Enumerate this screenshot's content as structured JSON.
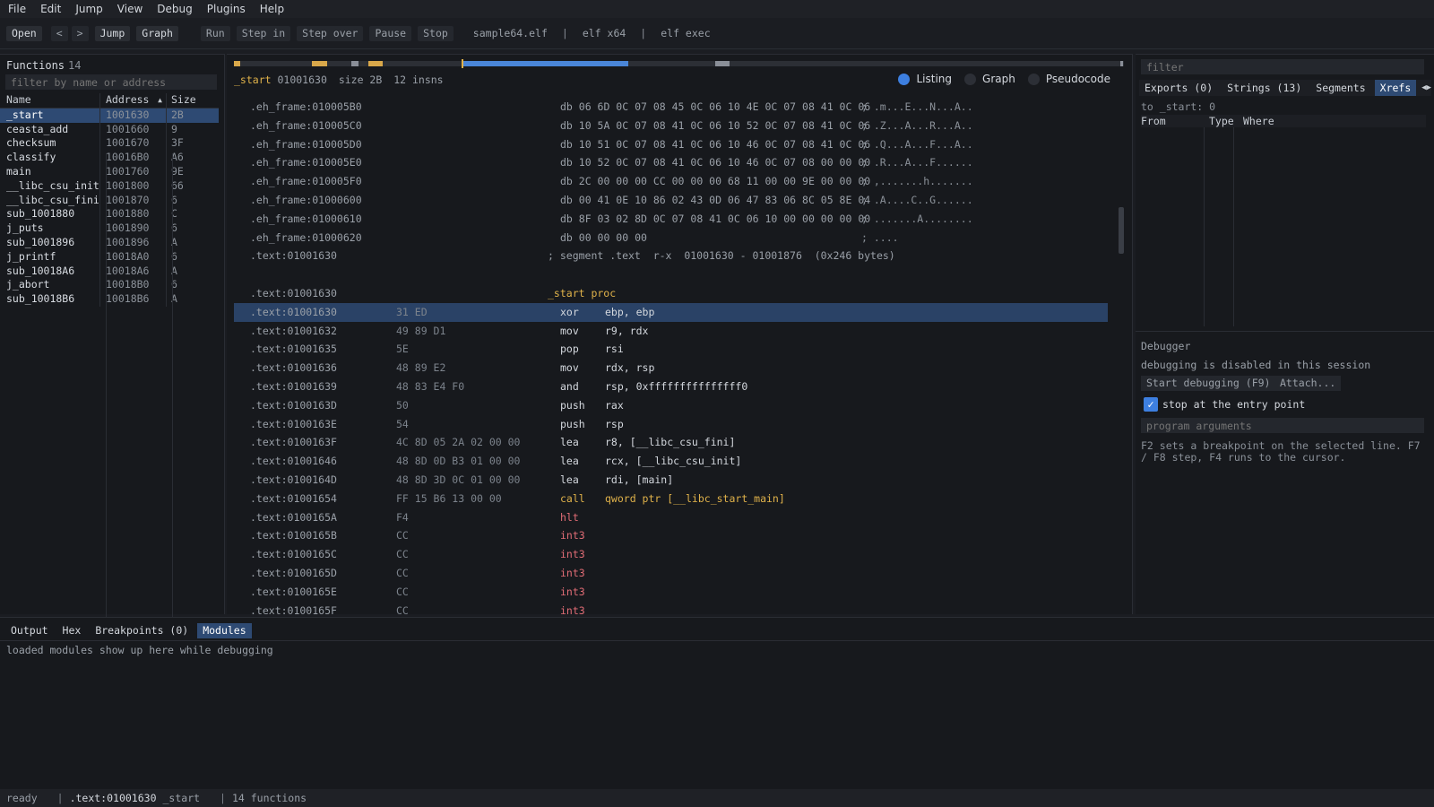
{
  "menu": [
    "File",
    "Edit",
    "Jump",
    "View",
    "Debug",
    "Plugins",
    "Help"
  ],
  "toolbar": {
    "open": "Open",
    "back": "<",
    "forward": ">",
    "jump": "Jump",
    "graph": "Graph",
    "run": "Run",
    "step_in": "Step in",
    "step_over": "Step over",
    "pause": "Pause",
    "stop": "Stop",
    "file": "sample64.elf",
    "sep": "|",
    "arch": "elf x64",
    "kind": "elf exec"
  },
  "functions": {
    "title": "Functions",
    "count": "14",
    "filter_placeholder": "filter by name or address",
    "columns": {
      "name": "Name",
      "address": "Address",
      "sort_indicator": "▲",
      "size": "Size"
    },
    "rows": [
      {
        "name": "_start",
        "address": "1001630",
        "size": "2B",
        "selected": true
      },
      {
        "name": "ceasta_add",
        "address": "1001660",
        "size": "9"
      },
      {
        "name": "checksum",
        "address": "1001670",
        "size": "3F"
      },
      {
        "name": "classify",
        "address": "10016B0",
        "size": "A6"
      },
      {
        "name": "main",
        "address": "1001760",
        "size": "9E"
      },
      {
        "name": "__libc_csu_init",
        "address": "1001800",
        "size": "66"
      },
      {
        "name": "__libc_csu_fini",
        "address": "1001870",
        "size": "6"
      },
      {
        "name": "sub_1001880",
        "address": "1001880",
        "size": "C"
      },
      {
        "name": "j_puts",
        "address": "1001890",
        "size": "6"
      },
      {
        "name": "sub_1001896",
        "address": "1001896",
        "size": "A"
      },
      {
        "name": "j_printf",
        "address": "10018A0",
        "size": "6"
      },
      {
        "name": "sub_10018A6",
        "address": "10018A6",
        "size": "A"
      },
      {
        "name": "j_abort",
        "address": "10018B0",
        "size": "6"
      },
      {
        "name": "sub_10018B6",
        "address": "10018B6",
        "size": "A"
      }
    ]
  },
  "center": {
    "func_name": "_start",
    "func_addr": "01001630",
    "func_size": "size 2B",
    "func_insns": "12 insns",
    "view_modes": [
      "Listing",
      "Graph",
      "Pseudocode"
    ],
    "active_view": "Listing",
    "colors": {
      "navbar_code": "#4a86d8",
      "navbar_data": "#d9a84a",
      "navbar_gray": "#8a8f98",
      "navbar_marker": "#e0b24a"
    },
    "listing": [
      {
        "t": "data",
        "addr": ".eh_frame:010005B0",
        "db": "db 06 6D 0C 07 08 45 0C 06 10 4E 0C 07 08 41 0C 06",
        "cmt": "; .m...E...N...A.."
      },
      {
        "t": "data",
        "addr": ".eh_frame:010005C0",
        "db": "db 10 5A 0C 07 08 41 0C 06 10 52 0C 07 08 41 0C 06",
        "cmt": "; .Z...A...R...A.."
      },
      {
        "t": "data",
        "addr": ".eh_frame:010005D0",
        "db": "db 10 51 0C 07 08 41 0C 06 10 46 0C 07 08 41 0C 06",
        "cmt": "; .Q...A...F...A.."
      },
      {
        "t": "data",
        "addr": ".eh_frame:010005E0",
        "db": "db 10 52 0C 07 08 41 0C 06 10 46 0C 07 08 00 00 00",
        "cmt": "; .R...A...F......"
      },
      {
        "t": "data",
        "addr": ".eh_frame:010005F0",
        "db": "db 2C 00 00 00 CC 00 00 00 68 11 00 00 9E 00 00 00",
        "cmt": "; ,.......h......."
      },
      {
        "t": "data",
        "addr": ".eh_frame:01000600",
        "db": "db 00 41 0E 10 86 02 43 0D 06 47 83 06 8C 05 8E 04",
        "cmt": "; .A....C..G......"
      },
      {
        "t": "data",
        "addr": ".eh_frame:01000610",
        "db": "db 8F 03 02 8D 0C 07 08 41 0C 06 10 00 00 00 00 00",
        "cmt": "; .......A........"
      },
      {
        "t": "data",
        "addr": ".eh_frame:01000620",
        "db": "db 00 00 00 00",
        "cmt": "; ...."
      },
      {
        "t": "seg",
        "addr": ".text:01001630",
        "text": "; segment .text  r-x  01001630 - 01001876  (0x246 bytes)"
      },
      {
        "t": "blank"
      },
      {
        "t": "proc",
        "addr": ".text:01001630",
        "text": "_start proc"
      },
      {
        "t": "ins",
        "addr": ".text:01001630",
        "bytes": "31 ED",
        "mn": "xor",
        "ops": "ebp, ebp",
        "sel": true
      },
      {
        "t": "ins",
        "addr": ".text:01001632",
        "bytes": "49 89 D1",
        "mn": "mov",
        "ops": "r9, rdx"
      },
      {
        "t": "ins",
        "addr": ".text:01001635",
        "bytes": "5E",
        "mn": "pop",
        "ops": "rsi"
      },
      {
        "t": "ins",
        "addr": ".text:01001636",
        "bytes": "48 89 E2",
        "mn": "mov",
        "ops": "rdx, rsp"
      },
      {
        "t": "ins",
        "addr": ".text:01001639",
        "bytes": "48 83 E4 F0",
        "mn": "and",
        "ops": "rsp, 0xfffffffffffffff0"
      },
      {
        "t": "ins",
        "addr": ".text:0100163D",
        "bytes": "50",
        "mn": "push",
        "ops": "rax"
      },
      {
        "t": "ins",
        "addr": ".text:0100163E",
        "bytes": "54",
        "mn": "push",
        "ops": "rsp"
      },
      {
        "t": "ins",
        "addr": ".text:0100163F",
        "bytes": "4C 8D 05 2A 02 00 00",
        "mn": "lea",
        "ops": "r8, [__libc_csu_fini]"
      },
      {
        "t": "ins",
        "addr": ".text:01001646",
        "bytes": "48 8D 0D B3 01 00 00",
        "mn": "lea",
        "ops": "rcx, [__libc_csu_init]"
      },
      {
        "t": "ins",
        "addr": ".text:0100164D",
        "bytes": "48 8D 3D 0C 01 00 00",
        "mn": "lea",
        "ops": "rdi, [main]"
      },
      {
        "t": "ins",
        "addr": ".text:01001654",
        "bytes": "FF 15 B6 13 00 00",
        "mn": "call",
        "ops": "qword ptr [__libc_start_main]",
        "kind": "call"
      },
      {
        "t": "ins",
        "addr": ".text:0100165A",
        "bytes": "F4",
        "mn": "hlt",
        "ops": "",
        "kind": "hlt"
      },
      {
        "t": "ins",
        "addr": ".text:0100165B",
        "bytes": "CC",
        "mn": "int3",
        "ops": "",
        "kind": "hlt"
      },
      {
        "t": "ins",
        "addr": ".text:0100165C",
        "bytes": "CC",
        "mn": "int3",
        "ops": "",
        "kind": "hlt"
      },
      {
        "t": "ins",
        "addr": ".text:0100165D",
        "bytes": "CC",
        "mn": "int3",
        "ops": "",
        "kind": "hlt"
      },
      {
        "t": "ins",
        "addr": ".text:0100165E",
        "bytes": "CC",
        "mn": "int3",
        "ops": "",
        "kind": "hlt"
      },
      {
        "t": "ins",
        "addr": ".text:0100165F",
        "bytes": "CC",
        "mn": "int3",
        "ops": "",
        "kind": "hlt"
      }
    ]
  },
  "right": {
    "filter_placeholder": "filter",
    "tabs": [
      "Exports (0)",
      "Strings (13)",
      "Segments",
      "Xrefs"
    ],
    "active_tab": "Xrefs",
    "xref_to": "to _start: 0",
    "xref_columns": [
      "From",
      "Type",
      "Where"
    ],
    "debugger": {
      "title": "Debugger",
      "status": "debugging is disabled in this session",
      "start": "Start debugging (F9)",
      "attach": "Attach...",
      "stop_entry": "stop at the entry point",
      "stop_entry_checked": true,
      "args_placeholder": "program arguments",
      "help": "F2 sets a breakpoint on the selected line. F7 / F8 step, F4 runs to the cursor."
    }
  },
  "bottom": {
    "tabs": [
      "Output",
      "Hex",
      "Breakpoints (0)",
      "Modules"
    ],
    "active_tab": "Modules",
    "message": "loaded modules show up here while debugging"
  },
  "status": {
    "state": "ready",
    "sep": "|",
    "address": ".text:01001630",
    "func": "_start",
    "functions": "14 functions"
  }
}
